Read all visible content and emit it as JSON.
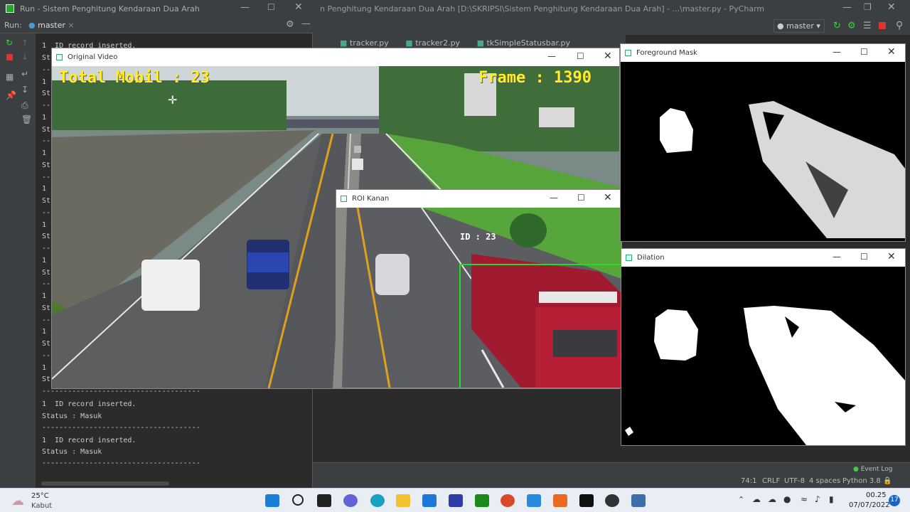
{
  "back_pycharm": {
    "title": "n Penghitung Kendaraan Dua Arah [D:\\SKRIPSI\\Sistem Penghitung Kendaraan Dua Arah] - ...\\master.py - PyCharm",
    "tabs": [
      "tracker.py",
      "tracker2.py",
      "tkSimpleStatusbar.py"
    ],
    "branch": "master",
    "event_log": "Event Log",
    "status": {
      "pos": "74:1",
      "eol": "CRLF",
      "enc": "UTF-8",
      "indent": "4 spaces",
      "python": "Python 3.8"
    }
  },
  "run_window": {
    "title": "Run - Sistem Penghitung Kendaraan Dua Arah",
    "run_label": "Run:",
    "run_tab": "master",
    "lines": [
      "1  ID record inserted.",
      "St",
      "--",
      "1",
      "St",
      "--",
      "1",
      "St",
      "--",
      "1",
      "St",
      "--",
      "1",
      "St",
      "--",
      "1",
      "St",
      "--",
      "1",
      "St",
      "--",
      "1",
      "St",
      "--",
      "1",
      "St",
      "--",
      "1",
      "St",
      "-------------------------------------",
      "1  ID record inserted.",
      "Status : Masuk",
      "-------------------------------------",
      "1  ID record inserted.",
      "Status : Masuk",
      "-------------------------------------"
    ]
  },
  "original_video": {
    "title": "Original Video",
    "overlay_count": "Total Mobil : 23",
    "overlay_frame": "Frame : 1390"
  },
  "roi_kanan": {
    "title": "ROI Kanan",
    "id_label": "ID : 23"
  },
  "foreground_mask": {
    "title": "Foreground Mask"
  },
  "dilation": {
    "title": "Dilation"
  },
  "taskbar": {
    "weather_temp": "25°C",
    "weather_desc": "Kabut",
    "time": "00.25",
    "date": "07/07/2022",
    "notif_count": "17",
    "apps": [
      "start",
      "search",
      "taskview",
      "chat",
      "edge",
      "explorer",
      "mail",
      "app-blue",
      "xbox",
      "chrome",
      "vscode",
      "xampp",
      "pycharm",
      "obs",
      "python"
    ]
  },
  "colors": {
    "accent_green": "#22dd22",
    "overlay_yellow": "#ffee22",
    "truck_red": "#b01830"
  }
}
